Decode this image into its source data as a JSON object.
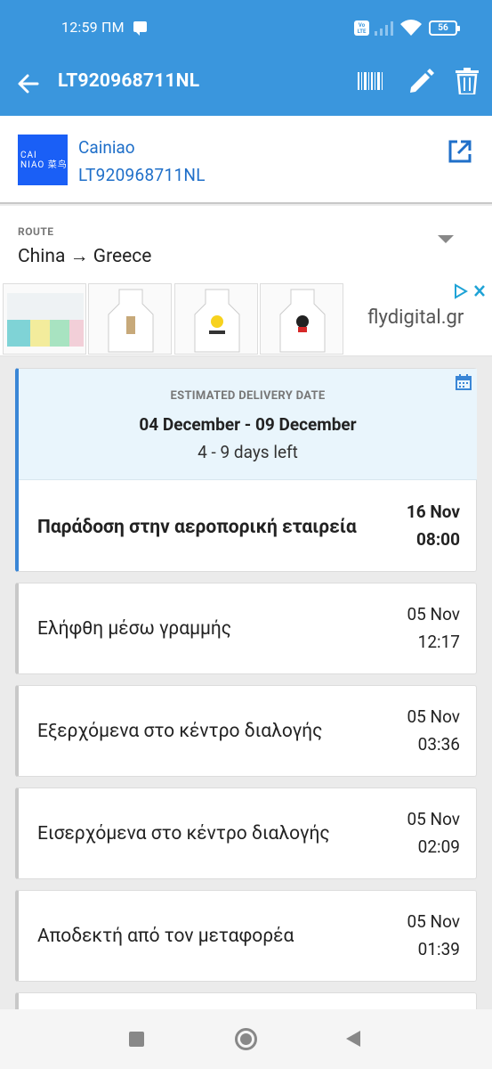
{
  "status_bar": {
    "time": "12:59 ΠΜ",
    "volte": "Vo LTE",
    "battery": "56"
  },
  "app_bar": {
    "title": "LT920968711NL",
    "icons": [
      "back-arrow-icon",
      "barcode-icon",
      "edit-pencil-icon",
      "delete-trash-icon"
    ]
  },
  "carrier": {
    "logo_text_line1": "CAI",
    "logo_text_line2": "NIAO 菜鸟",
    "name": "Cainiao",
    "tracking_number": "LT920968711NL"
  },
  "route": {
    "label": "ROUTE",
    "value": "China → Greece"
  },
  "ad": {
    "brand": "flydigital.gr"
  },
  "estimate": {
    "label": "ESTIMATED DELIVERY DATE",
    "dates": "04 December - 09 December",
    "days_left": "4 - 9 days left"
  },
  "events": [
    {
      "status": "Παράδοση στην αεροπορική εταιρεία",
      "date": "16 Nov",
      "time": "08:00",
      "active": true
    },
    {
      "status": "Ελήφθη μέσω γραμμής",
      "date": "05 Nov",
      "time": "12:17",
      "active": false
    },
    {
      "status": "Εξερχόμενα στο κέντρο διαλογής",
      "date": "05 Nov",
      "time": "03:36",
      "active": false
    },
    {
      "status": "Εισερχόμενα στο κέντρο διαλογής",
      "date": "05 Nov",
      "time": "02:09",
      "active": false
    },
    {
      "status": "Αποδεκτή από τον μεταφορέα",
      "date": "05 Nov",
      "time": "01:39",
      "active": false
    }
  ],
  "colors": {
    "primary": "#3a96dd",
    "link": "#1f6fc9",
    "estimate_bg": "#e9f5fc",
    "active_border": "#3a86d6"
  }
}
